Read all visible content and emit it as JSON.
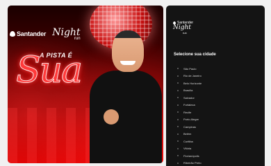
{
  "hero": {
    "bank_name": "Santander",
    "event_name": "Night",
    "event_suffix": "run",
    "headline_top": "A PISTA É",
    "headline_main": "Sua"
  },
  "panel": {
    "logo_bank": "Santander",
    "logo_event": "Night",
    "logo_suffix": "run",
    "title": "Selecione sua cidade",
    "cities": [
      "São Paulo",
      "Rio de Janeiro",
      "Belo Horizonte",
      "Brasília",
      "Salvador",
      "Fortaleza",
      "Recife",
      "Porto Alegre",
      "Campinas",
      "Belém",
      "Curitiba",
      "Vitória",
      "Florianópolis",
      "Ribeirão Preto"
    ]
  },
  "colors": {
    "hero_red": "#c40000",
    "headline_red": "#ff3a3a",
    "panel_bg": "#141414",
    "page_bg": "#f1f1f1"
  }
}
